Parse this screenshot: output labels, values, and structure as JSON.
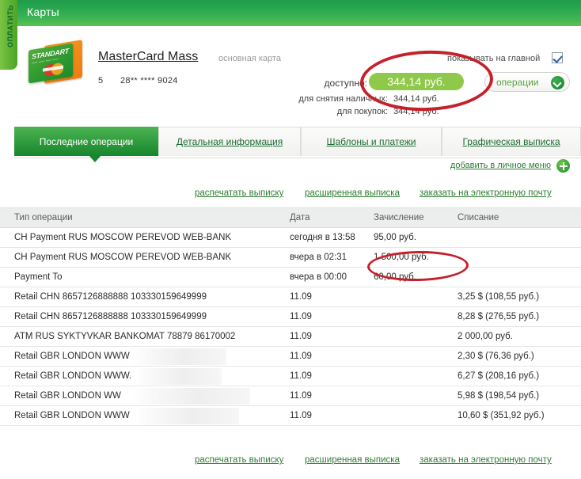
{
  "left_tab": {
    "label": "ОПЛАТИТЬ"
  },
  "header": {
    "title": "Карты"
  },
  "card": {
    "art_brand": "STANDART",
    "art_digits": "**** **** **** ****",
    "title": "MasterCard Mass",
    "subtitle": "основная карта",
    "sequence": "5",
    "number": "28** **** 9024",
    "show_on_main_label": "показывать на главной",
    "show_on_main_checked": true,
    "balance_label": "доступно:",
    "balance_value": "344,14 руб.",
    "cash_label": "для снятия наличных:",
    "cash_value": "344,14 руб.",
    "purchases_label": "для покупок:",
    "purchases_value": "344,14 руб.",
    "operations_button": "операции"
  },
  "tabs": [
    {
      "label": "Последние операции",
      "active": true
    },
    {
      "label": "Детальная информация",
      "active": false
    },
    {
      "label": "Шаблоны и платежи",
      "active": false
    },
    {
      "label": "Графическая выписка",
      "active": false
    }
  ],
  "add_to_menu": {
    "label": "добавить в личное меню",
    "icon": "plus-circle-icon"
  },
  "statement_links": {
    "print": "распечатать выписку",
    "extended": "расширенная выписка",
    "email": "заказать на электронную почту"
  },
  "table": {
    "columns": [
      "Тип операции",
      "Дата",
      "Зачисление",
      "Списание"
    ],
    "rows": [
      {
        "type": "CH Payment RUS MOSCOW PEREVOD WEB-BANK",
        "date": "сегодня в 13:58",
        "credit": "95,00 руб.",
        "debit": "",
        "redacted": false
      },
      {
        "type": "CH Payment RUS MOSCOW PEREVOD WEB-BANK",
        "date": "вчера в 02:31",
        "credit": "1 500,00 руб.",
        "debit": "",
        "redacted": false
      },
      {
        "type": "Payment To",
        "date": "вчера в 00:00",
        "credit": "60,00 руб.",
        "debit": "",
        "redacted": false
      },
      {
        "type": "Retail CHN 8657126888888 103330159649999",
        "date": "11.09",
        "credit": "",
        "debit": "3,25 $ (108,55 руб.)",
        "redacted": false
      },
      {
        "type": "Retail CHN 8657126888888 103330159649999",
        "date": "11.09",
        "credit": "",
        "debit": "8,28 $ (276,55 руб.)",
        "redacted": false
      },
      {
        "type": "ATM RUS SYKTYVKAR BANKOMAT 78879 86170002",
        "date": "11.09",
        "credit": "",
        "debit": "2 000,00 руб.",
        "redacted": false
      },
      {
        "type": "Retail GBR LONDON WWW",
        "date": "11.09",
        "credit": "",
        "debit": "2,30 $ (76,36 руб.)",
        "redacted": true
      },
      {
        "type": "Retail GBR LONDON WWW.",
        "date": "11.09",
        "credit": "",
        "debit": "6,27 $ (208,16 руб.)",
        "redacted": true
      },
      {
        "type": "Retail GBR LONDON WW",
        "date": "11.09",
        "credit": "",
        "debit": "5,98 $ (198,54 руб.)",
        "redacted": true
      },
      {
        "type": "Retail GBR LONDON WWW",
        "date": "11.09",
        "credit": "",
        "debit": "10,60 $ (351,92 руб.)",
        "redacted": true
      }
    ]
  },
  "annotations": {
    "balance_highlight_color": "#c6202a",
    "amount_highlight_color": "#c6202a"
  },
  "colors": {
    "brand_green": "#2aa84f",
    "accent_green": "#8fc94b",
    "link_green": "#2f7d33",
    "header_gray": "#eceeed"
  }
}
